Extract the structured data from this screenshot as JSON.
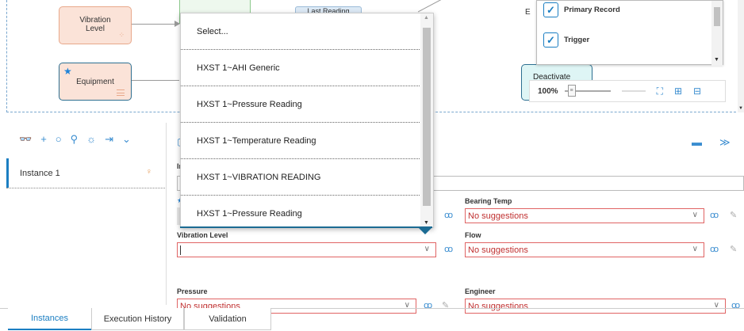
{
  "canvas": {
    "nodes": {
      "vibration_level": "Vibration Level",
      "equipment": "Equipment",
      "last_reading": "Last Reading",
      "deactivate": "Deactivate"
    },
    "panel": {
      "items": [
        {
          "label": "Primary Record",
          "checked": true
        },
        {
          "label": "Trigger",
          "checked": true
        }
      ],
      "fragment": "E"
    },
    "zoom": {
      "value": "100%"
    }
  },
  "toolbar_icons": [
    "binoculars-icon",
    "plus-icon",
    "ellipse-icon",
    "bulb-off-icon",
    "bulb-settings-icon",
    "export-icon",
    "chevron-down-icon"
  ],
  "instances": [
    {
      "label": "Instance 1"
    }
  ],
  "dropdown": {
    "options": [
      "Select...",
      "HXST 1~AHI Generic",
      "HXST 1~Pressure Reading",
      "HXST 1~Temperature Reading",
      "HXST 1~VIBRATION READING",
      "HXST 1~Pressure Reading"
    ]
  },
  "form": {
    "fragment_label": "In",
    "fields": {
      "bearing_temp": {
        "label": "Bearing Temp",
        "value": "No suggestions"
      },
      "vibration_level": {
        "label": "Vibration Level",
        "value": ""
      },
      "flow": {
        "label": "Flow",
        "value": "No suggestions"
      },
      "pressure": {
        "label": "Pressure",
        "value": "No suggestions"
      },
      "engineer": {
        "label": "Engineer",
        "value": "No suggestions"
      }
    }
  },
  "tabs": [
    {
      "label": "Instances",
      "active": true
    },
    {
      "label": "Execution History",
      "active": false
    },
    {
      "label": "Validation",
      "active": false
    }
  ],
  "colors": {
    "accent": "#1b7ec2",
    "error": "#e06464",
    "node_fill": "#fbe3d8"
  }
}
